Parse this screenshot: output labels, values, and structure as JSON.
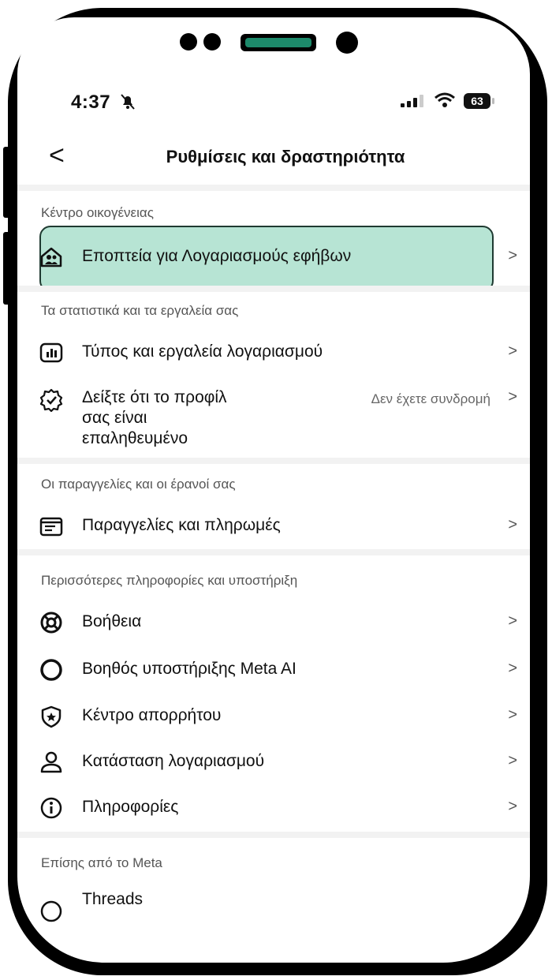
{
  "status_bar": {
    "time": "4:37",
    "battery": "63"
  },
  "header": {
    "back_label": "<",
    "title": "Ρυθμίσεις και δραστηριότητα"
  },
  "sections": {
    "family": "Κέντρο οικογένειας",
    "insights": "Τα στατιστικά και τα εργαλεία σας",
    "orders": "Οι παραγγελίες και οι έρανοί σας",
    "more": "Περισσότερες πληροφορίες και υποστήριξη",
    "also": "Επίσης από το Meta"
  },
  "items": {
    "supervision": "Εποπτεία για Λογαριασμούς εφήβων",
    "account_tools": "Τύπος και εργαλεία λογαριασμού",
    "verified_line1": "Δείξτε ότι το προφίλ",
    "verified_line2": "σας είναι",
    "verified_line3": "επαληθευμένο",
    "verified_value": "Δεν έχετε συνδρομή",
    "orders_payments": "Παραγγελίες και πληρωμές",
    "help": "Βοήθεια",
    "meta_ai": "Βοηθός υποστήριξης Meta AI",
    "privacy_center": "Κέντρο απορρήτου",
    "account_status": "Κατάσταση λογαριασμού",
    "about": "Πληροφορίες",
    "threads": "Threads"
  },
  "chevron": ">",
  "colors": {
    "highlight": "#b7e4d4",
    "highlight_border": "#1f3a31",
    "accent": "#1d8a6b"
  }
}
